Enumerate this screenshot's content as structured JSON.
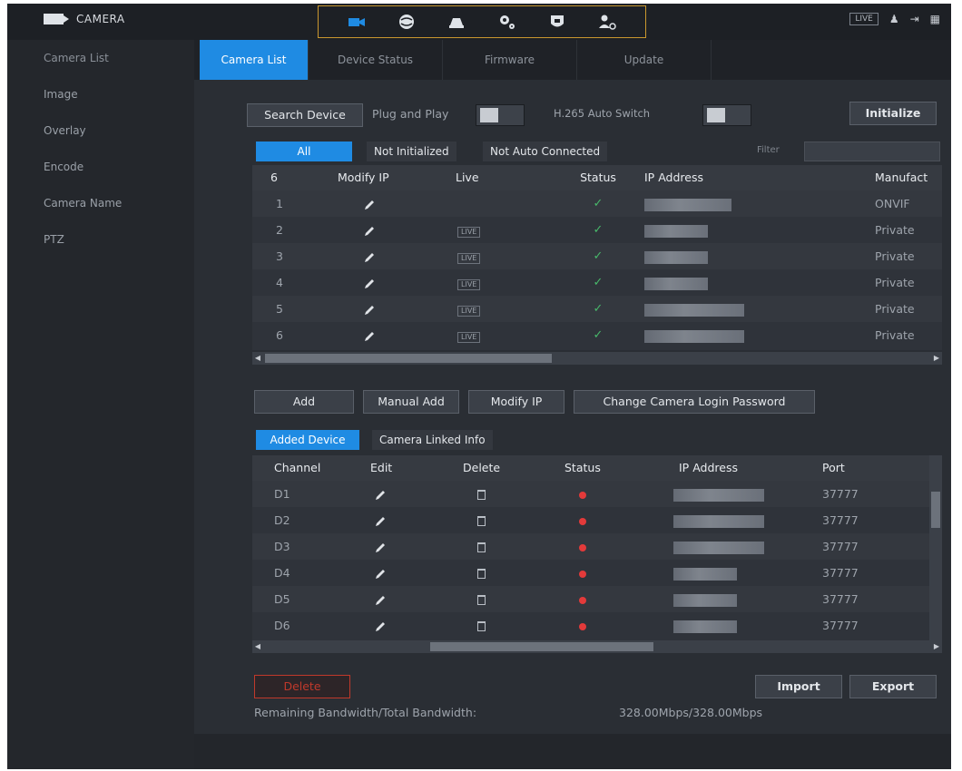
{
  "app": {
    "title": "CAMERA"
  },
  "top": {
    "live_label": "LIVE",
    "menu_icons": [
      "camera-icon",
      "network-icon",
      "storage-icon",
      "system-icon",
      "security-icon",
      "account-icon"
    ],
    "right_icons": [
      "user-icon",
      "logout-icon",
      "grid-icon"
    ]
  },
  "sidebar": {
    "items": [
      {
        "label": "Camera List"
      },
      {
        "label": "Image"
      },
      {
        "label": "Overlay"
      },
      {
        "label": "Encode"
      },
      {
        "label": "Camera Name"
      },
      {
        "label": "PTZ"
      }
    ]
  },
  "tabs": [
    {
      "label": "Camera List",
      "active": true
    },
    {
      "label": "Device Status"
    },
    {
      "label": "Firmware"
    },
    {
      "label": "Update"
    }
  ],
  "toolbar": {
    "search_device": "Search Device",
    "plug_and_play": "Plug and Play",
    "h265_auto_switch": "H.265 Auto Switch",
    "initialize": "Initialize"
  },
  "filters": {
    "all": "All",
    "not_initialized": "Not Initialized",
    "not_auto_connected": "Not Auto Connected",
    "filter_label": "Filter"
  },
  "search_table": {
    "headers": [
      "6",
      "",
      "Modify IP",
      "Live",
      "Status",
      "IP Address",
      "Manufact"
    ],
    "rows": [
      {
        "n": "1",
        "live": "",
        "manufacturer": "ONVIF"
      },
      {
        "n": "2",
        "live": "LIVE",
        "manufacturer": "Private"
      },
      {
        "n": "3",
        "live": "LIVE",
        "manufacturer": "Private"
      },
      {
        "n": "4",
        "live": "LIVE",
        "manufacturer": "Private"
      },
      {
        "n": "5",
        "live": "LIVE",
        "manufacturer": "Private"
      },
      {
        "n": "6",
        "live": "LIVE",
        "manufacturer": "Private"
      }
    ]
  },
  "actions": {
    "add": "Add",
    "manual_add": "Manual Add",
    "modify_ip": "Modify IP",
    "change_password": "Change Camera Login Password"
  },
  "added_tabs": {
    "added_device": "Added Device",
    "linked_info": "Camera Linked Info"
  },
  "added_table": {
    "headers": [
      "Channel",
      "Edit",
      "Delete",
      "Status",
      "IP Address",
      "Port"
    ],
    "rows": [
      {
        "channel": "D1",
        "port": "37777"
      },
      {
        "channel": "D2",
        "port": "37777"
      },
      {
        "channel": "D3",
        "port": "37777"
      },
      {
        "channel": "D4",
        "port": "37777"
      },
      {
        "channel": "D5",
        "port": "37777"
      },
      {
        "channel": "D6",
        "port": "37777"
      }
    ]
  },
  "footer": {
    "delete": "Delete",
    "import": "Import",
    "export": "Export",
    "bandwidth_label": "Remaining Bandwidth/Total Bandwidth:",
    "bandwidth_value": "328.00Mbps/328.00Mbps"
  },
  "colors": {
    "accent": "#1f8be3",
    "status_ok": "#48b86a",
    "status_offline": "#e33a3a",
    "menu_border": "#c9972e"
  }
}
